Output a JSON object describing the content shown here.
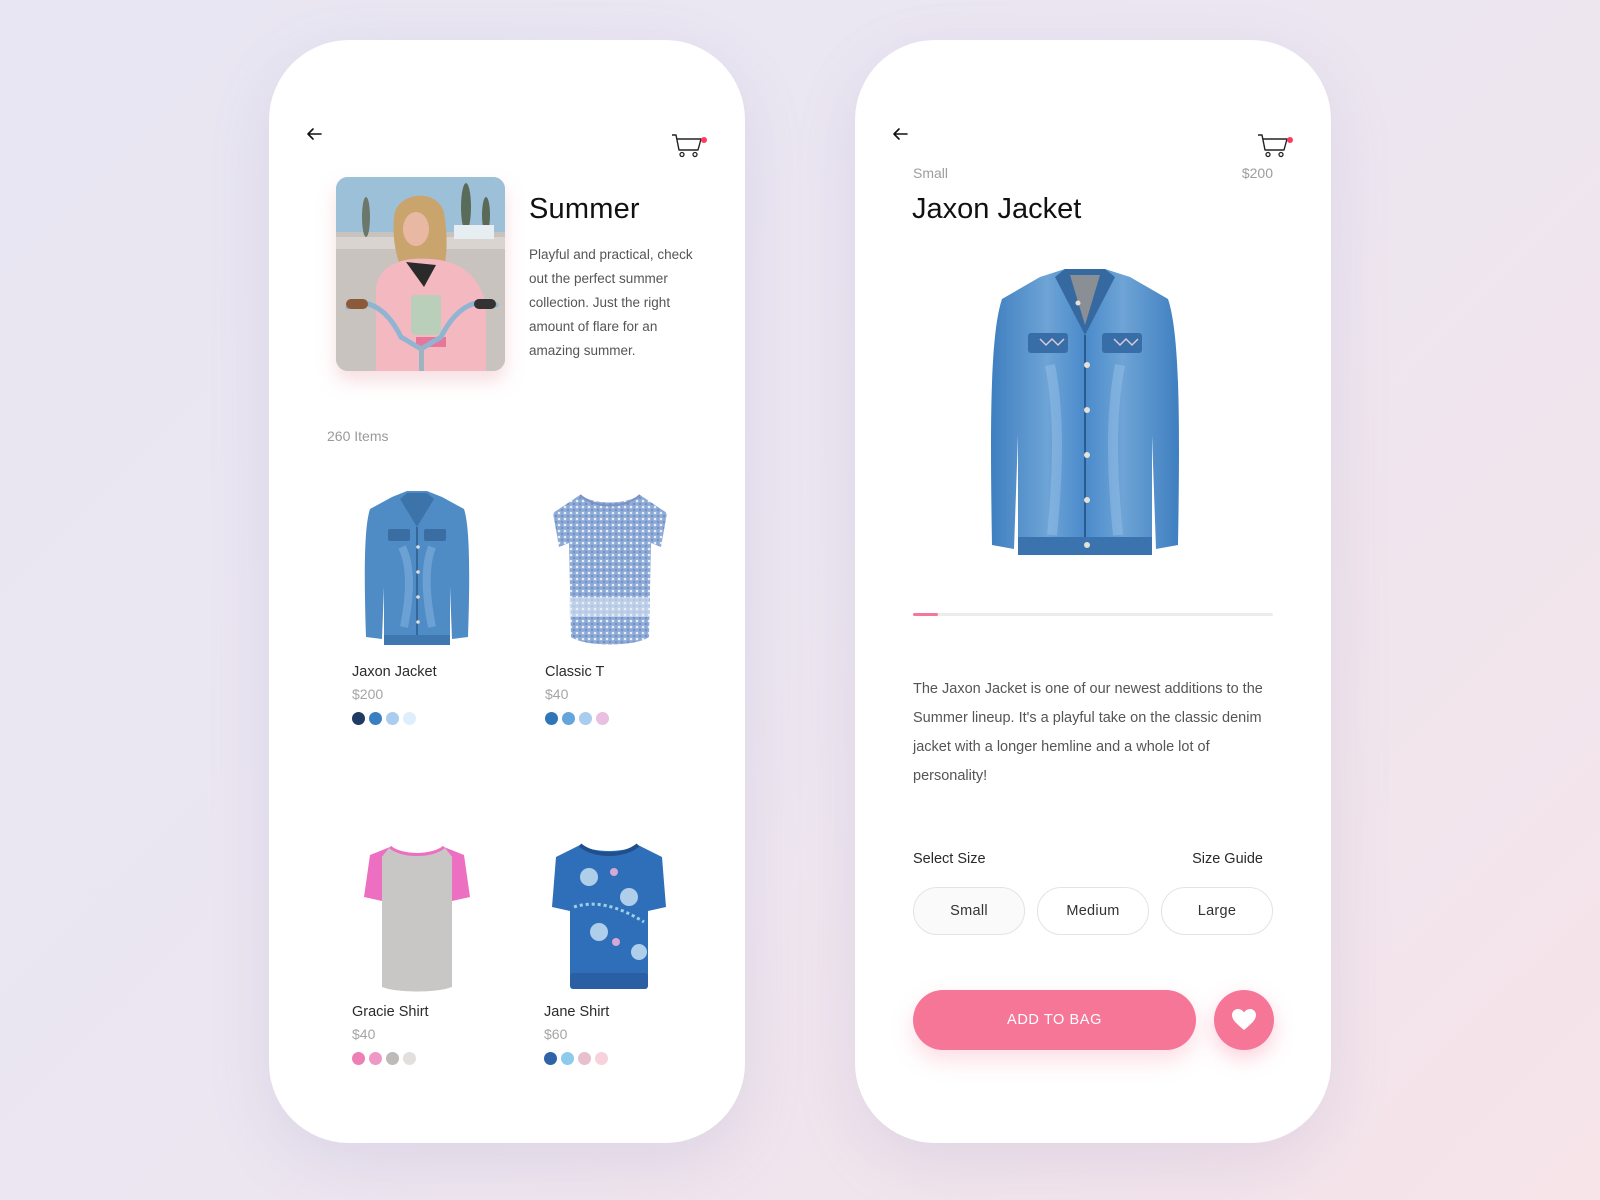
{
  "colors": {
    "accent": "#f67698",
    "cart_badge": "#ff3b5c",
    "background_start": "#e8e6f3",
    "background_end": "#f6e4e9"
  },
  "collection_screen": {
    "back_icon": "arrow-left-icon",
    "cart_icon": "shopping-cart-icon",
    "hero": {
      "title": "Summer",
      "description": "Playful and practical, check out the perfect summer collection. Just the right amount of flare for an amazing summer.",
      "image": "girl-on-bicycle-photo"
    },
    "items_count": "260 Items",
    "products": [
      {
        "name": "Jaxon Jacket",
        "price": "$200",
        "image": "denim-jacket",
        "swatches": [
          "#1f3a63",
          "#3a7fc1",
          "#a9cdee",
          "#ddeefc"
        ]
      },
      {
        "name": "Classic T",
        "price": "$40",
        "image": "floral-tshirt",
        "swatches": [
          "#2f76b8",
          "#64a6dc",
          "#a9cdee",
          "#e9bfe2"
        ]
      },
      {
        "name": "Gracie Shirt",
        "price": "$40",
        "image": "gray-pink-tshirt",
        "swatches": [
          "#ee7fb5",
          "#ef98c6",
          "#bdbab8",
          "#e2dfdd"
        ]
      },
      {
        "name": "Jane Shirt",
        "price": "$60",
        "image": "blue-print-shirt",
        "swatches": [
          "#2f63a8",
          "#8ccbec",
          "#e8bfcd",
          "#f7d2dd"
        ]
      }
    ]
  },
  "detail_screen": {
    "back_icon": "arrow-left-icon",
    "cart_icon": "shopping-cart-icon",
    "selected_size_label": "Small",
    "price": "$200",
    "title": "Jaxon Jacket",
    "image": "denim-jacket",
    "gallery_progress_percent": 7,
    "description": "The Jaxon Jacket is one of our newest additions to the Summer lineup. It's a playful take on the classic denim jacket with a longer hemline and a whole lot of personality!",
    "select_size_label": "Select Size",
    "size_guide_label": "Size Guide",
    "sizes": [
      "Small",
      "Medium",
      "Large"
    ],
    "selected_size_index": 0,
    "add_to_bag_label": "ADD TO BAG",
    "favorite_icon": "heart-icon"
  }
}
